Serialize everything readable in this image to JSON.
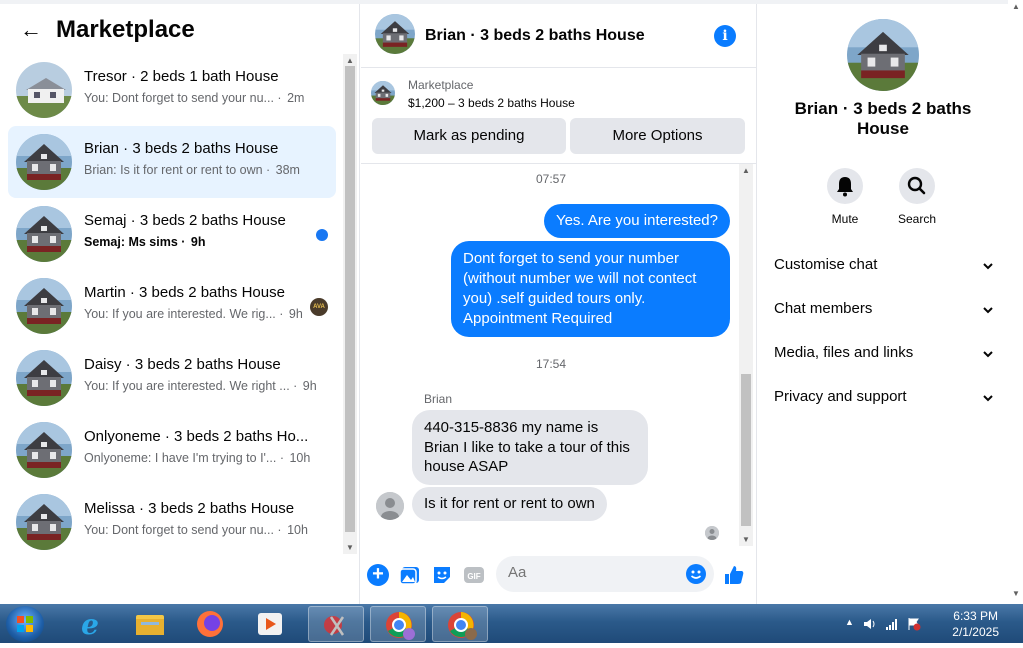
{
  "left": {
    "title": "Marketplace",
    "conversations": [
      {
        "name": "Tresor · 2 beds 1 bath House",
        "preview": "You: Dont forget to send your nu...",
        "time": "2m",
        "active": false,
        "unread": false
      },
      {
        "name": "Brian · 3 beds 2 baths House",
        "preview": "Brian: Is it for rent or rent to own",
        "time": "38m",
        "active": true,
        "unread": false
      },
      {
        "name": "Semaj · 3 beds 2 baths House",
        "preview": "Semaj: Ms sims",
        "time": "9h",
        "active": false,
        "unread": true
      },
      {
        "name": "Martin · 3 beds 2 baths House",
        "preview": "You: If you are interested. We rig...",
        "time": "9h",
        "active": false,
        "unread": false
      },
      {
        "name": "Daisy · 3 beds 2 baths House",
        "preview": "You: If you are interested. We right ...",
        "time": "9h",
        "active": false,
        "unread": false
      },
      {
        "name": "Onlyoneme · 3 beds 2 baths Ho...",
        "preview": "Onlyoneme: I have I'm trying to I'...",
        "time": "10h",
        "active": false,
        "unread": false
      },
      {
        "name": "Melissa · 3 beds 2 baths House",
        "preview": "You: Dont forget to send your nu...",
        "time": "10h",
        "active": false,
        "unread": false
      }
    ],
    "mini_avatar_text": "AVA"
  },
  "chat": {
    "title": "Brian · 3 beds 2 baths House",
    "info_icon": "i",
    "marketplace_label": "Marketplace",
    "listing": "$1,200 – 3 beds 2 baths House",
    "mark_pending": "Mark as pending",
    "more_options": "More Options",
    "timestamp1": "07:57",
    "msg_out1": "Yes. Are you interested?",
    "msg_out2": "Dont forget to send your number (without number we will not contect you) .self guided tours only. Appointment Required",
    "timestamp2": "17:54",
    "sender": "Brian",
    "msg_in1": "440-315-8836 my name is Brian I like to take a tour of this house ASAP",
    "msg_in2": "Is it for rent or rent to own",
    "input_placeholder": "Aa",
    "plus_icon": "+",
    "thumb_icon": "👍"
  },
  "right": {
    "name": "Brian · 3 beds 2 baths House",
    "mute": "Mute",
    "search": "Search",
    "sections": [
      "Customise chat",
      "Chat members",
      "Media, files and links",
      "Privacy and support"
    ]
  },
  "taskbar": {
    "time": "6:33 PM",
    "date": "2/1/2025"
  },
  "colors": {
    "accent": "#0a7cff",
    "active_row": "#e7f3ff",
    "incoming": "#e4e6eb"
  }
}
